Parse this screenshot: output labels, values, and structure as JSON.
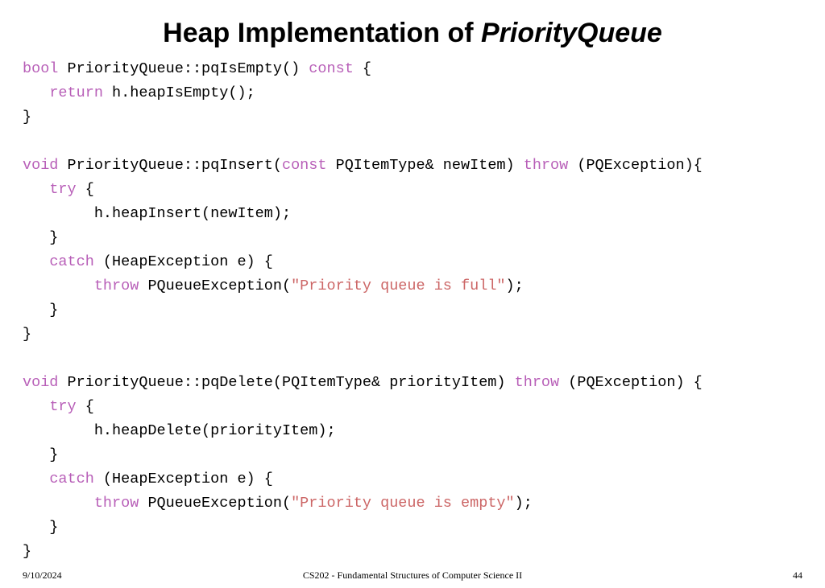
{
  "title": {
    "plain": "Heap Implementation of ",
    "em": "PriorityQueue"
  },
  "code": {
    "kw_bool": "bool",
    "l1_rest": " PriorityQueue::pqIsEmpty() ",
    "kw_const": "const",
    "l1_end": " {",
    "l2_indent": "   ",
    "kw_return": "return",
    "l2_rest": " h.heapIsEmpty();",
    "l3": "}",
    "blank1": "",
    "kw_void1": "void",
    "l5_a": " PriorityQueue::pqInsert(",
    "kw_const2": "const",
    "l5_b": " PQItemType& newItem) ",
    "kw_throw1": "throw",
    "l5_c": " (PQException){",
    "l6_indent": "   ",
    "kw_try1": "try",
    "l6_rest": " {",
    "l7": "        h.heapInsert(newItem);",
    "l8": "   }",
    "l9_indent": "   ",
    "kw_catch1": "catch",
    "l9_rest": " (HeapException e) {",
    "l10_indent": "        ",
    "kw_throw2": "throw",
    "l10_a": " PQueueException(",
    "str1": "\"Priority queue is full\"",
    "l10_b": ");",
    "l11": "   }",
    "l12": "}",
    "blank2": "",
    "kw_void2": "void",
    "l14_a": " PriorityQueue::pqDelete(PQItemType& priorityItem) ",
    "kw_throw3": "throw",
    "l14_b": " (PQException) {",
    "l15_indent": "   ",
    "kw_try2": "try",
    "l15_rest": " {",
    "l16": "        h.heapDelete(priorityItem);",
    "l17": "   }",
    "l18_indent": "   ",
    "kw_catch2": "catch",
    "l18_rest": " (HeapException e) {",
    "l19_indent": "        ",
    "kw_throw4": "throw",
    "l19_a": " PQueueException(",
    "str2": "\"Priority queue is empty\"",
    "l19_b": ");",
    "l20": "   }",
    "l21": "}"
  },
  "footer": {
    "date": "9/10/2024",
    "course": "CS202 - Fundamental Structures of Computer Science II",
    "page": "44"
  }
}
